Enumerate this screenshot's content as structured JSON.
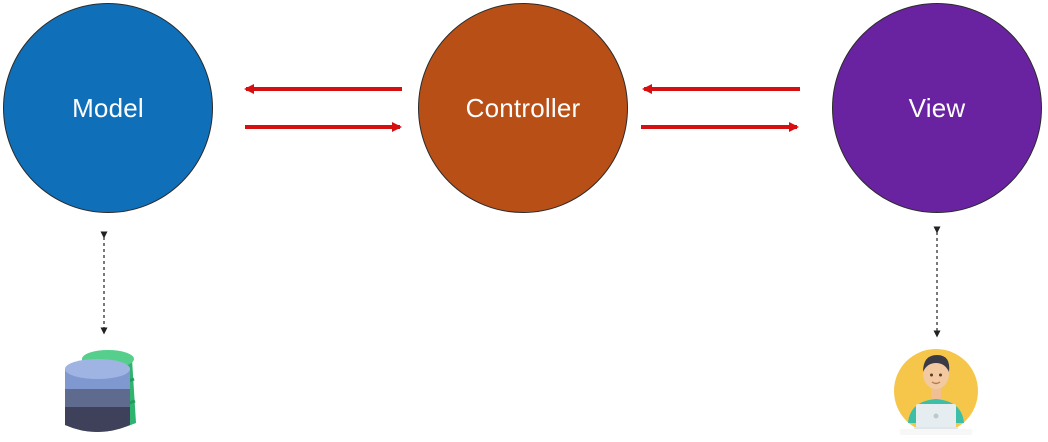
{
  "diagram": {
    "nodes": [
      {
        "id": "model",
        "label": "Model",
        "color": "#0f6fb9"
      },
      {
        "id": "controller",
        "label": "Controller",
        "color": "#b74f17"
      },
      {
        "id": "view",
        "label": "View",
        "color": "#6a23a0"
      }
    ],
    "arrow_color": "#d60f10",
    "connector_color": "#222222",
    "icons": [
      {
        "id": "database",
        "name": "database-icon"
      },
      {
        "id": "user",
        "name": "user-at-computer-icon"
      }
    ]
  }
}
